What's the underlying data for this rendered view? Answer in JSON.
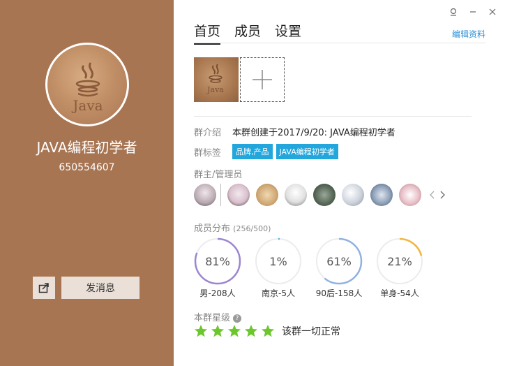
{
  "group": {
    "name": "JAVA编程初学者",
    "id": "650554607"
  },
  "left_actions": {
    "share_icon": "share-icon",
    "send_message_label": "发消息"
  },
  "window_controls": [
    "skin-icon",
    "minimize-icon",
    "close-icon"
  ],
  "tabs": [
    {
      "label": "首页",
      "active": true
    },
    {
      "label": "成员",
      "active": false
    },
    {
      "label": "设置",
      "active": false
    }
  ],
  "edit_profile_label": "编辑资料",
  "info": {
    "intro_label": "群介绍",
    "intro_value": "本群创建于2017/9/20:  JAVA编程初学者",
    "tags_label": "群标签",
    "tags": [
      "品牌,产品",
      "JAVA编程初学者"
    ]
  },
  "admins_section": {
    "label": "群主/管理员",
    "avatar_colors": [
      "#d9d4d6",
      "#e4d8e0",
      "#cfa774",
      "#e0e0e0",
      "#5a6a5a",
      "#cdd2dc",
      "#8ea0b8",
      "#e8c0c8"
    ]
  },
  "members_section": {
    "label": "成员分布",
    "count": "(256/500)",
    "stats": [
      {
        "percent": "81%",
        "value": 0.81,
        "label": "男-208人",
        "color": "#9b86d0"
      },
      {
        "percent": "1%",
        "value": 0.01,
        "label": "南京-5人",
        "color": "#4fb5e6"
      },
      {
        "percent": "61%",
        "value": 0.61,
        "label": "90后-158人",
        "color": "#8fb2e0"
      },
      {
        "percent": "21%",
        "value": 0.21,
        "label": "单身-54人",
        "color": "#f0b640"
      }
    ]
  },
  "rating_section": {
    "label": "本群星级",
    "stars": 5,
    "status_text": "该群一切正常",
    "star_color": "#6bc72c"
  }
}
